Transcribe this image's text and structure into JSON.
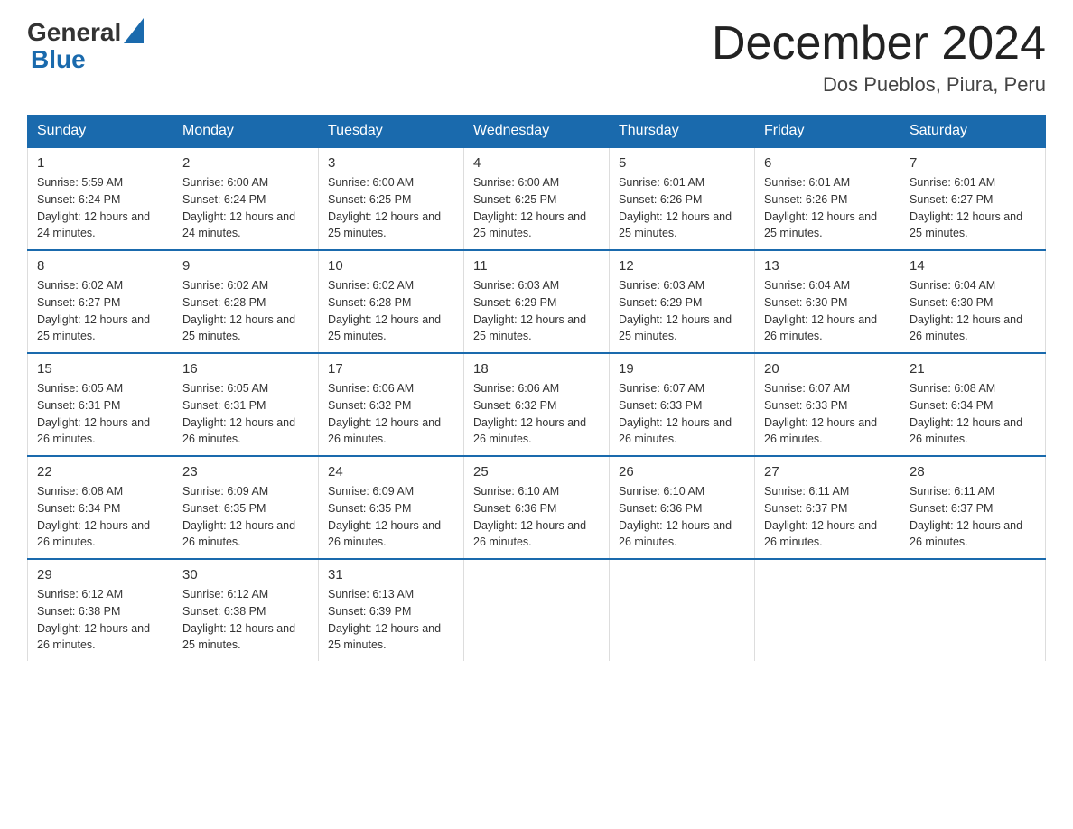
{
  "header": {
    "logo_text_general": "General",
    "logo_text_blue": "Blue",
    "month_title": "December 2024",
    "location": "Dos Pueblos, Piura, Peru"
  },
  "days_of_week": [
    "Sunday",
    "Monday",
    "Tuesday",
    "Wednesday",
    "Thursday",
    "Friday",
    "Saturday"
  ],
  "weeks": [
    [
      {
        "day": "1",
        "sunrise": "5:59 AM",
        "sunset": "6:24 PM",
        "daylight": "12 hours and 24 minutes."
      },
      {
        "day": "2",
        "sunrise": "6:00 AM",
        "sunset": "6:24 PM",
        "daylight": "12 hours and 24 minutes."
      },
      {
        "day": "3",
        "sunrise": "6:00 AM",
        "sunset": "6:25 PM",
        "daylight": "12 hours and 25 minutes."
      },
      {
        "day": "4",
        "sunrise": "6:00 AM",
        "sunset": "6:25 PM",
        "daylight": "12 hours and 25 minutes."
      },
      {
        "day": "5",
        "sunrise": "6:01 AM",
        "sunset": "6:26 PM",
        "daylight": "12 hours and 25 minutes."
      },
      {
        "day": "6",
        "sunrise": "6:01 AM",
        "sunset": "6:26 PM",
        "daylight": "12 hours and 25 minutes."
      },
      {
        "day": "7",
        "sunrise": "6:01 AM",
        "sunset": "6:27 PM",
        "daylight": "12 hours and 25 minutes."
      }
    ],
    [
      {
        "day": "8",
        "sunrise": "6:02 AM",
        "sunset": "6:27 PM",
        "daylight": "12 hours and 25 minutes."
      },
      {
        "day": "9",
        "sunrise": "6:02 AM",
        "sunset": "6:28 PM",
        "daylight": "12 hours and 25 minutes."
      },
      {
        "day": "10",
        "sunrise": "6:02 AM",
        "sunset": "6:28 PM",
        "daylight": "12 hours and 25 minutes."
      },
      {
        "day": "11",
        "sunrise": "6:03 AM",
        "sunset": "6:29 PM",
        "daylight": "12 hours and 25 minutes."
      },
      {
        "day": "12",
        "sunrise": "6:03 AM",
        "sunset": "6:29 PM",
        "daylight": "12 hours and 25 minutes."
      },
      {
        "day": "13",
        "sunrise": "6:04 AM",
        "sunset": "6:30 PM",
        "daylight": "12 hours and 26 minutes."
      },
      {
        "day": "14",
        "sunrise": "6:04 AM",
        "sunset": "6:30 PM",
        "daylight": "12 hours and 26 minutes."
      }
    ],
    [
      {
        "day": "15",
        "sunrise": "6:05 AM",
        "sunset": "6:31 PM",
        "daylight": "12 hours and 26 minutes."
      },
      {
        "day": "16",
        "sunrise": "6:05 AM",
        "sunset": "6:31 PM",
        "daylight": "12 hours and 26 minutes."
      },
      {
        "day": "17",
        "sunrise": "6:06 AM",
        "sunset": "6:32 PM",
        "daylight": "12 hours and 26 minutes."
      },
      {
        "day": "18",
        "sunrise": "6:06 AM",
        "sunset": "6:32 PM",
        "daylight": "12 hours and 26 minutes."
      },
      {
        "day": "19",
        "sunrise": "6:07 AM",
        "sunset": "6:33 PM",
        "daylight": "12 hours and 26 minutes."
      },
      {
        "day": "20",
        "sunrise": "6:07 AM",
        "sunset": "6:33 PM",
        "daylight": "12 hours and 26 minutes."
      },
      {
        "day": "21",
        "sunrise": "6:08 AM",
        "sunset": "6:34 PM",
        "daylight": "12 hours and 26 minutes."
      }
    ],
    [
      {
        "day": "22",
        "sunrise": "6:08 AM",
        "sunset": "6:34 PM",
        "daylight": "12 hours and 26 minutes."
      },
      {
        "day": "23",
        "sunrise": "6:09 AM",
        "sunset": "6:35 PM",
        "daylight": "12 hours and 26 minutes."
      },
      {
        "day": "24",
        "sunrise": "6:09 AM",
        "sunset": "6:35 PM",
        "daylight": "12 hours and 26 minutes."
      },
      {
        "day": "25",
        "sunrise": "6:10 AM",
        "sunset": "6:36 PM",
        "daylight": "12 hours and 26 minutes."
      },
      {
        "day": "26",
        "sunrise": "6:10 AM",
        "sunset": "6:36 PM",
        "daylight": "12 hours and 26 minutes."
      },
      {
        "day": "27",
        "sunrise": "6:11 AM",
        "sunset": "6:37 PM",
        "daylight": "12 hours and 26 minutes."
      },
      {
        "day": "28",
        "sunrise": "6:11 AM",
        "sunset": "6:37 PM",
        "daylight": "12 hours and 26 minutes."
      }
    ],
    [
      {
        "day": "29",
        "sunrise": "6:12 AM",
        "sunset": "6:38 PM",
        "daylight": "12 hours and 26 minutes."
      },
      {
        "day": "30",
        "sunrise": "6:12 AM",
        "sunset": "6:38 PM",
        "daylight": "12 hours and 25 minutes."
      },
      {
        "day": "31",
        "sunrise": "6:13 AM",
        "sunset": "6:39 PM",
        "daylight": "12 hours and 25 minutes."
      },
      null,
      null,
      null,
      null
    ]
  ],
  "labels": {
    "sunrise": "Sunrise:",
    "sunset": "Sunset:",
    "daylight": "Daylight:"
  }
}
